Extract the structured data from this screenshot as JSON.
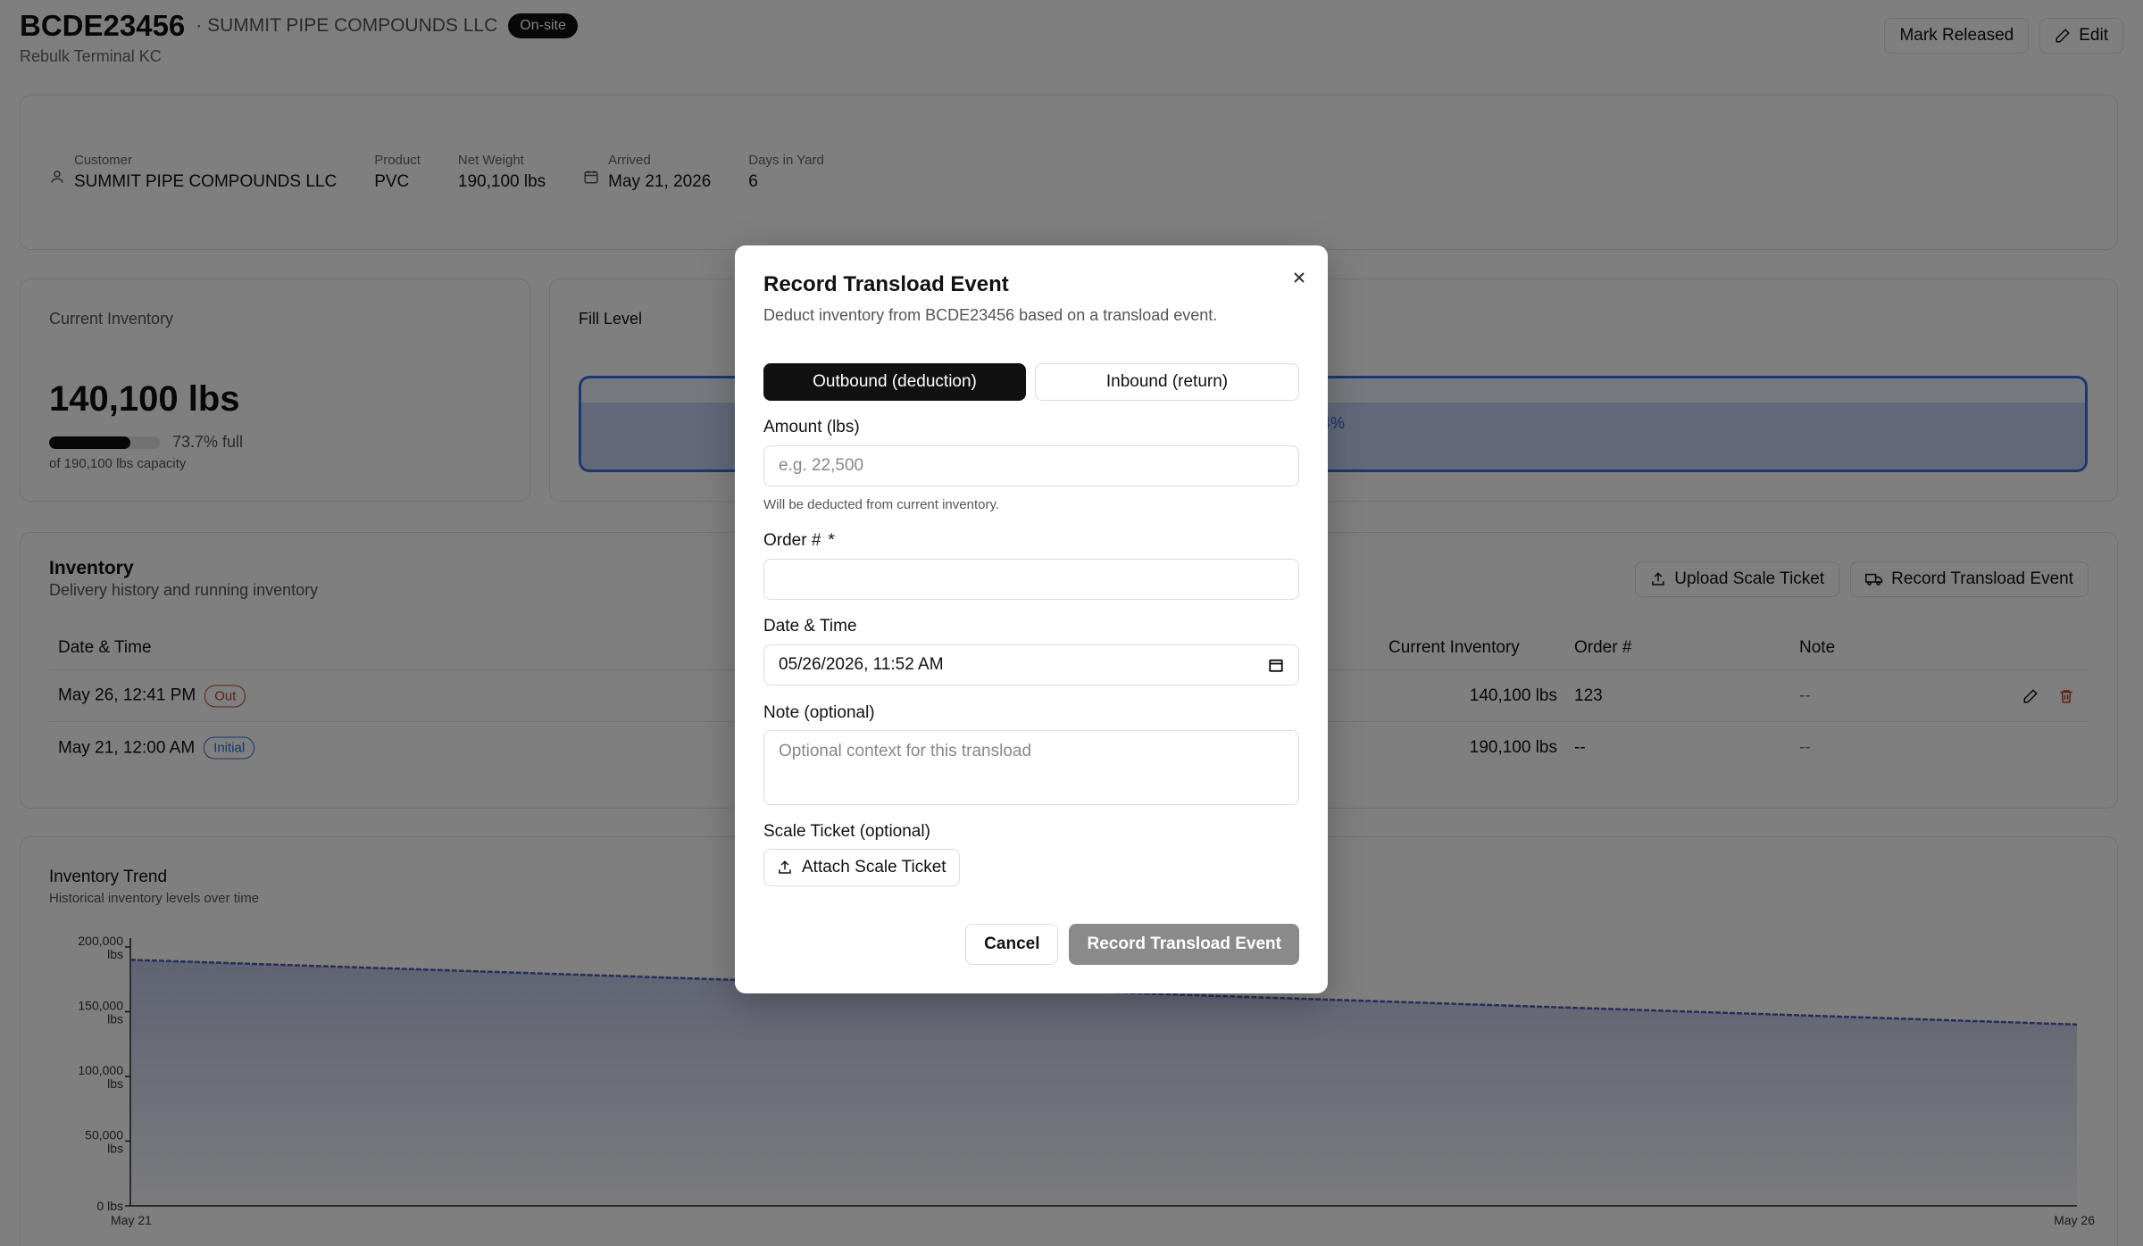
{
  "header": {
    "id": "BCDE23456",
    "customer": "· SUMMIT PIPE COMPOUNDS LLC",
    "status_badge": "On-site",
    "terminal": "Rebulk Terminal KC",
    "mark_released_label": "Mark Released",
    "edit_label": "Edit"
  },
  "info": {
    "customer_label": "Customer",
    "customer_value": "SUMMIT PIPE COMPOUNDS LLC",
    "product_label": "Product",
    "product_value": "PVC",
    "net_weight_label": "Net Weight",
    "net_weight_value": "190,100 lbs",
    "arrived_label": "Arrived",
    "arrived_value": "May 21, 2026",
    "days_label": "Days in Yard",
    "days_value": "6"
  },
  "current_inventory": {
    "title": "Current Inventory",
    "value": "140,100 lbs",
    "fill_fraction": 0.737,
    "pct_text": "73.7% full",
    "capacity_text": "of 190,100 lbs capacity"
  },
  "fill_level": {
    "title": "Fill Level",
    "fraction": 0.737,
    "pct_text": "4%"
  },
  "inventory_table": {
    "title": "Inventory",
    "subtitle": "Delivery history and running inventory",
    "upload_label": "Upload Scale Ticket",
    "record_label": "Record Transload Event",
    "columns": {
      "datetime": "Date & Time",
      "current_inventory": "Current Inventory",
      "order": "Order #",
      "note": "Note"
    },
    "rows": [
      {
        "datetime": "May 26, 12:41 PM",
        "tag": "Out",
        "current_inventory": "140,100 lbs",
        "order": "123",
        "note": "--"
      },
      {
        "datetime": "May 21, 12:00 AM",
        "tag": "Initial",
        "current_inventory": "190,100 lbs",
        "order": "--",
        "note": "--"
      }
    ]
  },
  "trend": {
    "title": "Inventory Trend",
    "subtitle": "Historical inventory levels over time"
  },
  "chart_data": {
    "type": "area",
    "x": [
      "May 21",
      "May 26"
    ],
    "series": [
      {
        "values": [
          190100,
          140100
        ]
      }
    ],
    "y_ticks": [
      {
        "v": 200000,
        "l1": "200,000",
        "l2": "lbs"
      },
      {
        "v": 150000,
        "l1": "150,000",
        "l2": "lbs"
      },
      {
        "v": 100000,
        "l1": "100,000",
        "l2": "lbs"
      },
      {
        "v": 50000,
        "l1": "50,000",
        "l2": "lbs"
      },
      {
        "v": 0,
        "l1": "0 lbs",
        "l2": ""
      }
    ],
    "ylim": [
      0,
      200000
    ],
    "x_ticks": [
      "May 21",
      "May 26"
    ],
    "color": "#4a5fb8"
  },
  "modal": {
    "title": "Record Transload Event",
    "description": "Deduct inventory from BCDE23456 based on a transload event.",
    "tab_outbound": "Outbound (deduction)",
    "tab_inbound": "Inbound (return)",
    "amount_label": "Amount (lbs)",
    "amount_placeholder": "e.g. 22,500",
    "amount_help": "Will be deducted from current inventory.",
    "order_label": "Order #",
    "order_required": "*",
    "order_value": "",
    "datetime_label": "Date & Time",
    "datetime_value": "05/26/2026, 11:52  AM",
    "note_label": "Note (optional)",
    "note_placeholder": "Optional context for this transload",
    "scale_label": "Scale Ticket (optional)",
    "attach_label": "Attach Scale Ticket",
    "cancel_label": "Cancel",
    "submit_label": "Record Transload Event"
  }
}
